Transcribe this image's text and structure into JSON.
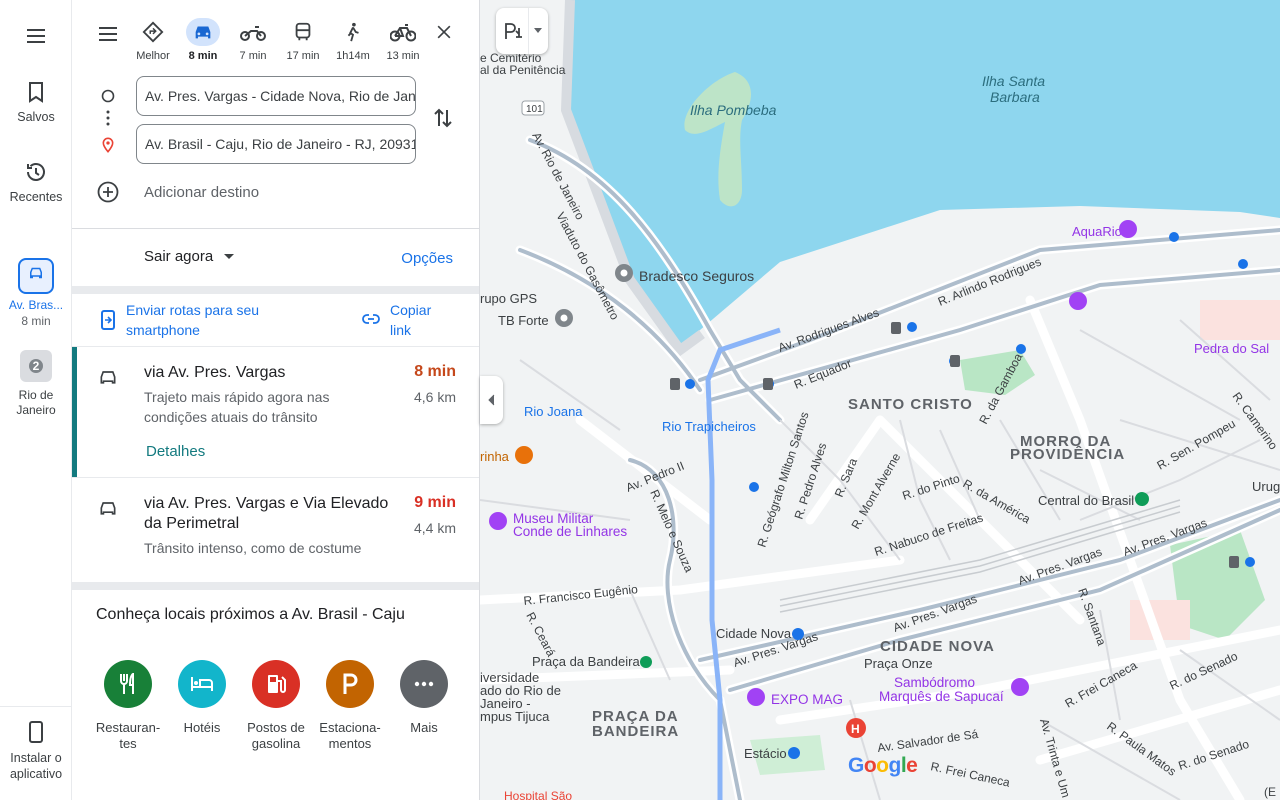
{
  "rail": {
    "menu_icon": "menu-icon",
    "saved_label": "Salvos",
    "recent_label": "Recentes",
    "active_route_label": "Av. Bras...",
    "active_route_time": "8 min",
    "city_label": "Rio de Janeiro",
    "city_badge": "2",
    "install_label": "Instalar o aplicativo"
  },
  "modes": [
    {
      "name": "best",
      "label": "Melhor"
    },
    {
      "name": "car",
      "label": "8 min"
    },
    {
      "name": "motorcycle",
      "label": "7 min"
    },
    {
      "name": "transit",
      "label": "17 min"
    },
    {
      "name": "walk",
      "label": "1h14m"
    },
    {
      "name": "bike",
      "label": "13 min"
    }
  ],
  "origin": "Av. Pres. Vargas - Cidade Nova, Rio de Janeiro",
  "destination": "Av. Brasil - Caju, Rio de Janeiro - RJ, 20931",
  "add_destination": "Adicionar destino",
  "depart_label": "Sair agora",
  "options_label": "Opções",
  "send_label": "Enviar rotas para seu smartphone",
  "copy_label": "Copiar link",
  "routes": [
    {
      "title": "via Av. Pres. Vargas",
      "subtitle": "Trajeto mais rápido agora nas condições atuais do trânsito",
      "time": "8 min",
      "distance": "4,6 km",
      "details": "Detalhes",
      "time_color": "#c5481b"
    },
    {
      "title": "via Av. Pres. Vargas e Via Elevado da Perimetral",
      "subtitle": "Trânsito intenso, como de costume",
      "time": "9 min",
      "distance": "4,4 km",
      "time_color": "#d93025"
    }
  ],
  "nearby_title": "Conheça locais próximos a Av. Brasil - Caju",
  "categories": [
    {
      "label": "Restauran-tes",
      "color": "#188038",
      "icon": "fork-knife-icon"
    },
    {
      "label": "Hotéis",
      "color": "#12b5cb",
      "icon": "bed-icon"
    },
    {
      "label": "Postos de gasolina",
      "color": "#d93025",
      "icon": "gas-station-icon"
    },
    {
      "label": "Estaciona-mentos",
      "color": "#c26401",
      "icon": "parking-icon"
    },
    {
      "label": "Mais",
      "color": "#5f6368",
      "icon": "more-icon"
    }
  ],
  "map": {
    "water_color": "#8ed6ee",
    "land_color": "#f1f3f4",
    "route_color": "#8ab4f8",
    "labels": {
      "ilha_pombeba": "Ilha Pombeba",
      "ilha_santa_barbara_1": "Ilha Santa",
      "ilha_santa_barbara_2": "Barbara",
      "cemiterio_1": "e Cemitério",
      "cemiterio_2": "al da Penitência",
      "hwy_101": "101",
      "av_rio_de_janeiro": "Av. Rio de Janeiro",
      "viaduto_gasometro": "Viaduto do Gasômetro",
      "bradesco": "Bradesco Seguros",
      "grupo_gps": "rupo GPS",
      "tb_forte": "TB Forte",
      "aquario": "AquaRio",
      "av_rodrigues_alves": "Av. Rodrigues Alves",
      "r_arlindo_rodrigues": "R. Arlindo Rodrigues",
      "r_equador": "R. Equador",
      "santo_cristo": "SANTO CRISTO",
      "r_da_gamboa": "R. da Gamboa",
      "pedra_do_sal": "Pedra do Sal",
      "morro_1": "MORRO DA",
      "morro_2": "PROVIDÊNCIA",
      "rio_joana": "Rio Joana",
      "rio_trapicheiros": "Rio Trapicheiros",
      "r_camerino": "R. Camerino",
      "r_sen_pompeu": "R. Sen. Pompeu",
      "urug": "Urug",
      "rinha": "rinha",
      "av_pedro_ii": "Av. Pedro II",
      "r_melo_souza": "R. Melo e Souza",
      "r_geografo": "R. Geógrafo Milton Santos",
      "r_pedro_alves": "R. Pedro Alves",
      "r_sara": "R. Sara",
      "r_mont_alverne": "R. Mont Alverne",
      "r_do_pinto": "R. do Pinto",
      "r_da_america": "R. da América",
      "central_brasil": "Central do Brasil",
      "r_nabuco": "R. Nabuco de Freitas",
      "museu_1": "Museu Militar",
      "museu_2": "Conde de Linhares",
      "r_francisco_eugenio": "R. Francisco Eugênio",
      "av_pres_vargas": "Av. Pres. Vargas",
      "r_ceara": "R. Ceará",
      "cidade_nova_station": "Cidade Nova",
      "cidade_nova": "CIDADE NOVA",
      "praca_bandeira_station": "Praça da Bandeira",
      "praca_onze": "Praça Onze",
      "sambodromo_1": "Sambódromo",
      "sambodromo_2": "Marquês de Sapucaí",
      "r_santana": "R. Santana",
      "r_frei_caneca": "R. Frei Caneca",
      "r_do_senado": "R. do Senado",
      "univ_1": "iversidade",
      "univ_2": "ado do Rio de",
      "univ_3": "Janeiro -",
      "univ_4": "mpus Tijuca",
      "expo_mag": "EXPO MAG",
      "praca_1": "PRAÇA DA",
      "praca_2": "BANDEIRA",
      "av_salvador": "Av. Salvador de Sá",
      "estacio": "Estácio",
      "r_paula_matos": "R. Paula Matos",
      "trinta_1": "Av. Trinta e Um de",
      "hospital": "Hospital São",
      "e_paren": "(E"
    }
  },
  "google_logo": "Google"
}
